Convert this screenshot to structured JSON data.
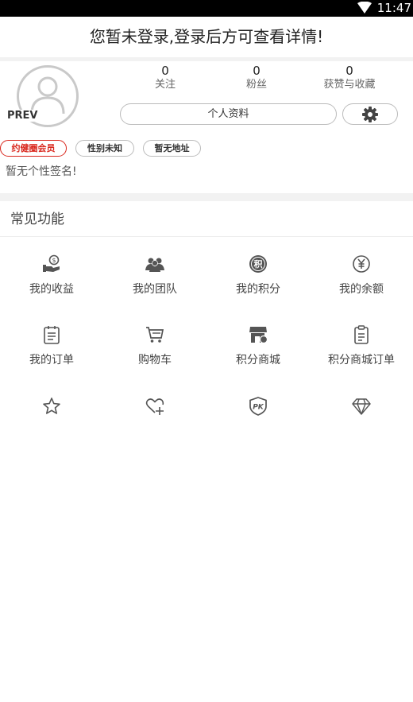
{
  "status_bar": {
    "time": "11:47"
  },
  "login_banner": {
    "text": "您暂未登录,登录后方可查看详情!"
  },
  "profile": {
    "avatar_label": "PREV",
    "stats": [
      {
        "value": "0",
        "label": "关注"
      },
      {
        "value": "0",
        "label": "粉丝"
      },
      {
        "value": "0",
        "label": "获赞与收藏"
      }
    ],
    "profile_button": "个人资料",
    "tags": [
      "约健圈会员",
      "性别未知",
      "暂无地址"
    ],
    "signature": "暂无个性签名!"
  },
  "functions": {
    "title": "常见功能",
    "items": [
      {
        "label": "我的收益",
        "icon": "earnings-icon"
      },
      {
        "label": "我的团队",
        "icon": "team-icon"
      },
      {
        "label": "我的积分",
        "icon": "points-icon"
      },
      {
        "label": "我的余额",
        "icon": "yuan-icon"
      },
      {
        "label": "我的订单",
        "icon": "order-list-icon"
      },
      {
        "label": "购物车",
        "icon": "cart-icon"
      },
      {
        "label": "积分商城",
        "icon": "store-icon"
      },
      {
        "label": "积分商城订单",
        "icon": "clipboard-icon"
      }
    ],
    "unlabeled_icons": [
      "star-icon",
      "heart-plus-icon",
      "pk-shield-icon",
      "diamond-icon"
    ]
  },
  "colors": {
    "accent": "#d9261c",
    "icon": "#555555"
  }
}
